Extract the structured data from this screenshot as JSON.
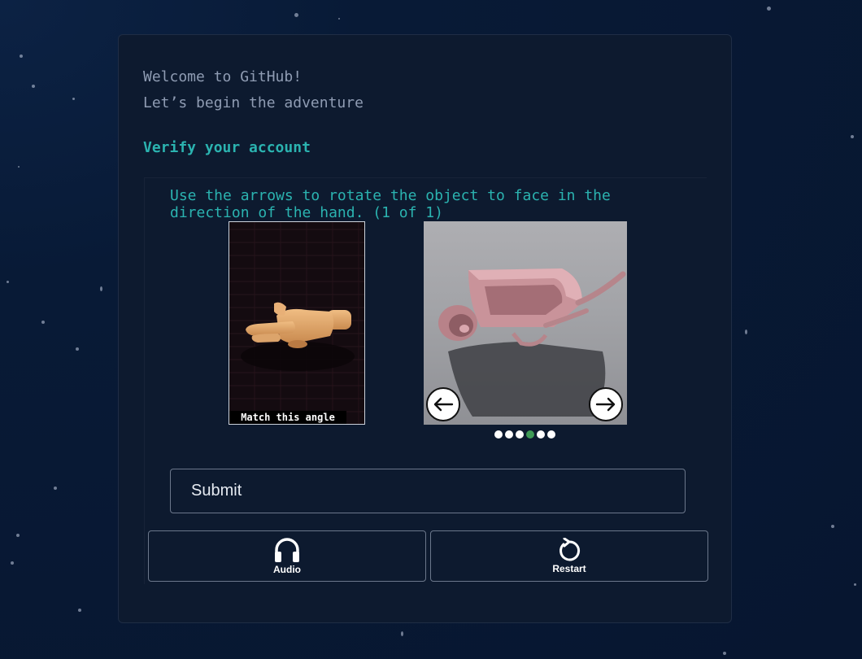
{
  "header": {
    "welcome_line1": "Welcome to GitHub!",
    "welcome_line2": "Let’s begin the adventure"
  },
  "verify": {
    "title": "Verify your account",
    "instruction": "Use the arrows to rotate the object to face in the direction of the hand. (1 of 1)",
    "reference_label": "Match this angle",
    "progress_dots": {
      "total": 6,
      "active_index": 3
    },
    "submit_label": "Submit",
    "audio_label": "Audio",
    "restart_label": "Restart"
  },
  "colors": {
    "accent": "#2bb3b0",
    "card_bg": "#0d1a2f",
    "active_dot": "#3f9a56"
  },
  "icons": [
    "headphones-icon",
    "restart-icon",
    "arrow-left-icon",
    "arrow-right-icon"
  ]
}
